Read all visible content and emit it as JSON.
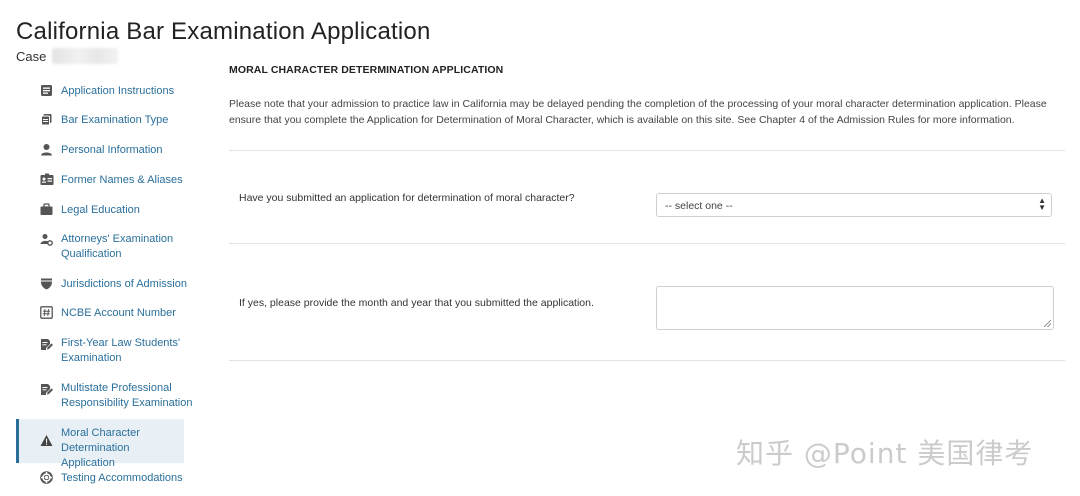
{
  "app": {
    "title": "California Bar Examination Application",
    "case_label": "Case"
  },
  "sidebar": {
    "items": [
      {
        "label": "Application Instructions",
        "icon": "list-icon"
      },
      {
        "label": "Bar Examination Type",
        "icon": "copy-icon"
      },
      {
        "label": "Personal Information",
        "icon": "user-icon"
      },
      {
        "label": "Former Names & Aliases",
        "icon": "id-card-icon"
      },
      {
        "label": "Legal Education",
        "icon": "briefcase-icon"
      },
      {
        "label": "Attorneys' Examination Qualification",
        "icon": "user-gear-icon"
      },
      {
        "label": "Jurisdictions of Admission",
        "icon": "shield-icon"
      },
      {
        "label": "NCBE Account Number",
        "icon": "hash-icon"
      },
      {
        "label": "First-Year Law Students' Examination",
        "icon": "edit-doc-icon"
      },
      {
        "label": "Multistate Professional Responsibility Examination",
        "icon": "edit-doc-icon"
      },
      {
        "label": "Moral Character Determination Application",
        "icon": "warning-icon",
        "active": true
      },
      {
        "label": "Testing Accommodations",
        "icon": "lifebuoy-icon"
      }
    ]
  },
  "main": {
    "section_title": "MORAL CHARACTER DETERMINATION APPLICATION",
    "notice": "Please note that your admission to practice law in California may be delayed pending the completion of the processing of your moral character determination application. Please ensure that you complete the Application for Determination of Moral Character, which is available on this site. See Chapter 4 of the Admission Rules for more information.",
    "q1": {
      "label": "Have you submitted an application for determination of moral character?",
      "selected": "-- select one --"
    },
    "q2": {
      "label": "If yes, please provide the month and year that you submitted the application.",
      "value": ""
    }
  },
  "watermark": "知乎 @Point 美国律考",
  "colors": {
    "link": "#2a6f9b",
    "active_bg": "#e8f0f6",
    "active_border": "#2a6f9b"
  }
}
